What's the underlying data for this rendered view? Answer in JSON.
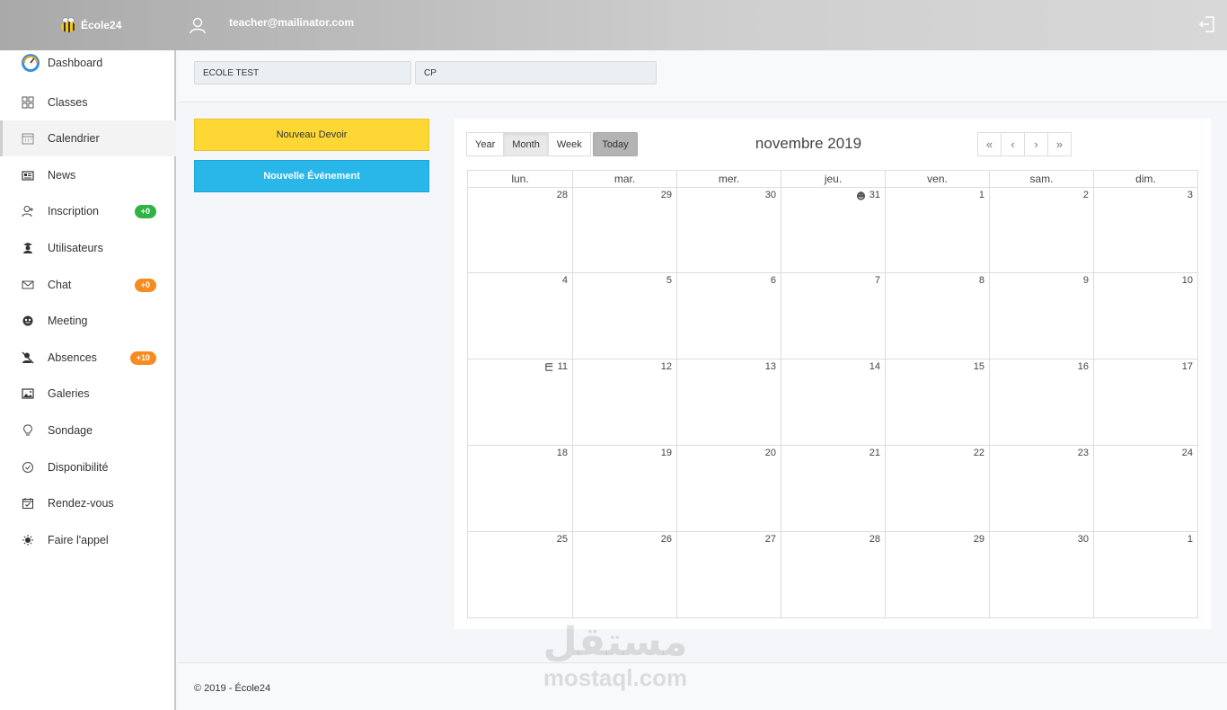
{
  "header": {
    "brand": "École24",
    "user_email": "teacher@mailinator.com"
  },
  "sidebar": {
    "items": [
      {
        "label": "Dashboard",
        "icon": "dashboard-gauge-icon"
      },
      {
        "label": "Classes",
        "icon": "grid-icon"
      },
      {
        "label": "Calendrier",
        "icon": "calendar-icon",
        "active": true
      },
      {
        "label": "News",
        "icon": "newspaper-icon"
      },
      {
        "label": "Inscription",
        "icon": "user-plus-icon",
        "badge": "+0",
        "badge_color": "#2fb344"
      },
      {
        "label": "Utilisateurs",
        "icon": "users-icon"
      },
      {
        "label": "Chat",
        "icon": "envelope-icon",
        "badge": "+0",
        "badge_color": "#f68b1f"
      },
      {
        "label": "Meeting",
        "icon": "meeting-icon"
      },
      {
        "label": "Absences",
        "icon": "user-slash-icon",
        "badge": "+10",
        "badge_color": "#f68b1f"
      },
      {
        "label": "Galeries",
        "icon": "images-icon"
      },
      {
        "label": "Sondage",
        "icon": "lightbulb-icon"
      },
      {
        "label": "Disponibilité",
        "icon": "check-circle-icon"
      },
      {
        "label": "Rendez-vous",
        "icon": "calendar-check-icon"
      },
      {
        "label": "Faire l'appel",
        "icon": "sun-icon"
      }
    ]
  },
  "filters": {
    "school": "ECOLE TEST",
    "class": "CP"
  },
  "actions": {
    "new_homework": "Nouveau Devoir",
    "new_event": "Nouvelle Événement"
  },
  "calendar": {
    "views": [
      "Year",
      "Month",
      "Week"
    ],
    "selected_view": "Month",
    "today_label": "Today",
    "title": "novembre 2019",
    "nav": [
      "«",
      "‹",
      "›",
      "»"
    ],
    "weekdays": [
      "lun.",
      "mar.",
      "mer.",
      "jeu.",
      "ven.",
      "sam.",
      "dim."
    ],
    "weeks": [
      [
        "28",
        "29",
        "30",
        "31",
        "1",
        "2",
        "3"
      ],
      [
        "4",
        "5",
        "6",
        "7",
        "8",
        "9",
        "10"
      ],
      [
        "11",
        "12",
        "13",
        "14",
        "15",
        "16",
        "17"
      ],
      [
        "18",
        "19",
        "20",
        "21",
        "22",
        "23",
        "24"
      ],
      [
        "25",
        "26",
        "27",
        "28",
        "29",
        "30",
        "1"
      ]
    ]
  },
  "footer": {
    "text": "© 2019 - École24"
  },
  "watermark": {
    "arabic": "مستقل",
    "latin": "mostaql.com"
  }
}
